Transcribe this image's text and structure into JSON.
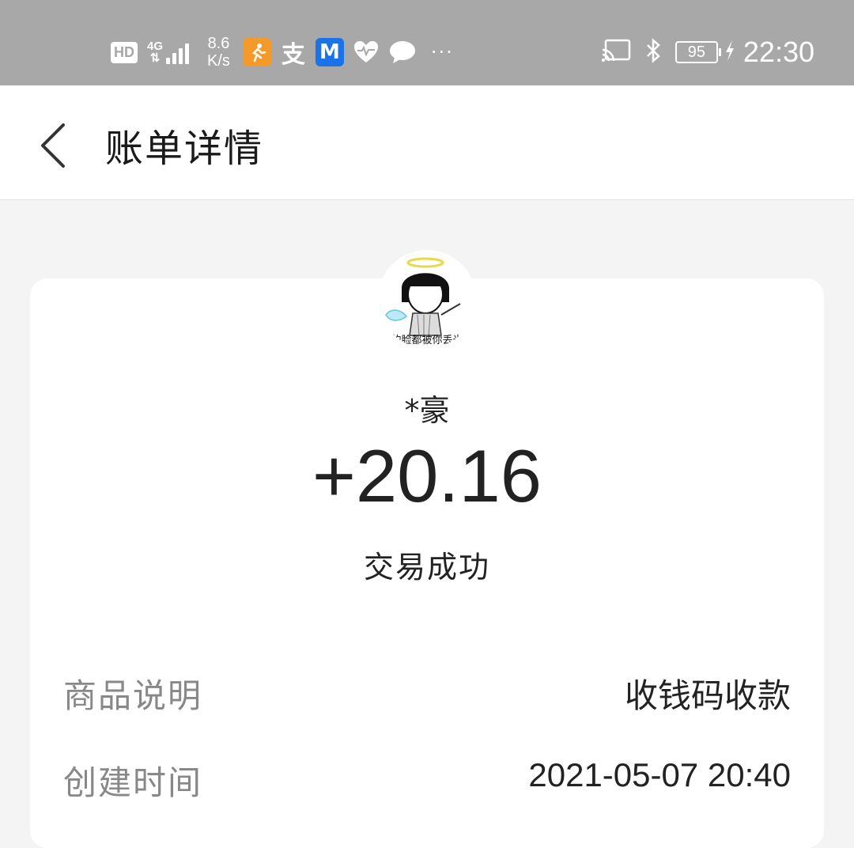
{
  "status_bar": {
    "hd": "HD",
    "network": "4G",
    "speed_value": "8.6",
    "speed_unit": "K/s",
    "more": "···",
    "battery": "95",
    "time": "22:30",
    "app_icons": [
      "running-app-icon",
      "alipay-icon",
      "meituan-icon",
      "health-icon",
      "chat-icon"
    ],
    "icons": [
      "cast-icon",
      "bluetooth-icon",
      "charging-icon"
    ]
  },
  "navbar": {
    "title": "账单详情",
    "back_icon": "chevron-left-icon"
  },
  "transaction": {
    "avatar_caption": "的脸都被你丢光",
    "payer": "*豪",
    "amount": "+20.16",
    "status": "交易成功"
  },
  "details": [
    {
      "label": "商品说明",
      "value": "收钱码收款"
    },
    {
      "label": "创建时间",
      "value": "2021-05-07 20:40"
    }
  ],
  "colors": {
    "status_bar_bg": "#a8a8a8",
    "page_bg": "#f4f4f4",
    "card_bg": "#ffffff",
    "label_gray": "#888888",
    "text_dark": "#222222"
  }
}
